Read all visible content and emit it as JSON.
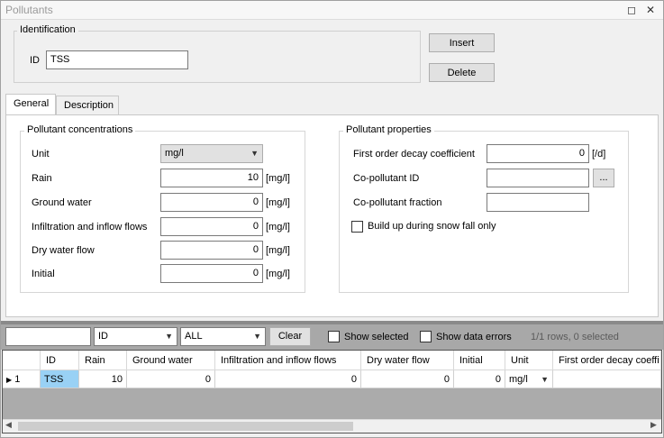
{
  "window": {
    "title": "Pollutants"
  },
  "identification": {
    "legend": "Identification",
    "id_label": "ID",
    "id_value": "TSS",
    "insert_label": "Insert",
    "delete_label": "Delete"
  },
  "tabs": [
    {
      "label": "General",
      "active": true
    },
    {
      "label": "Description",
      "active": false
    }
  ],
  "concentrations": {
    "legend": "Pollutant concentrations",
    "unit_label": "Unit",
    "unit_value": "mg/l",
    "unit_suffix": "[mg/l]",
    "rows": [
      {
        "label": "Rain",
        "value": "10"
      },
      {
        "label": "Ground water",
        "value": "0"
      },
      {
        "label": "Infiltration and inflow flows",
        "value": "0"
      },
      {
        "label": "Dry water flow",
        "value": "0"
      },
      {
        "label": "Initial",
        "value": "0"
      }
    ]
  },
  "properties": {
    "legend": "Pollutant properties",
    "decay_label": "First order decay coefficient",
    "decay_value": "0",
    "decay_unit": "[/d]",
    "copollutant_id_label": "Co-pollutant ID",
    "copollutant_id_value": "",
    "browse_label": "...",
    "copollutant_fraction_label": "Co-pollutant fraction",
    "copollutant_fraction_value": "",
    "snow_label": "Build up during snow fall only"
  },
  "filter": {
    "search_value": "",
    "field_value": "ID",
    "scope_value": "ALL",
    "clear_label": "Clear",
    "show_selected_label": "Show selected",
    "show_errors_label": "Show data errors",
    "status": "1/1 rows, 0 selected"
  },
  "grid": {
    "headers": [
      "ID",
      "Rain",
      "Ground water",
      "Infiltration and inflow flows",
      "Dry water flow",
      "Initial",
      "Unit",
      "First order decay coeffi"
    ],
    "rows": [
      {
        "num": "1",
        "cells": [
          "TSS",
          "10",
          "0",
          "0",
          "0",
          "0",
          "mg/l",
          ""
        ]
      }
    ]
  }
}
